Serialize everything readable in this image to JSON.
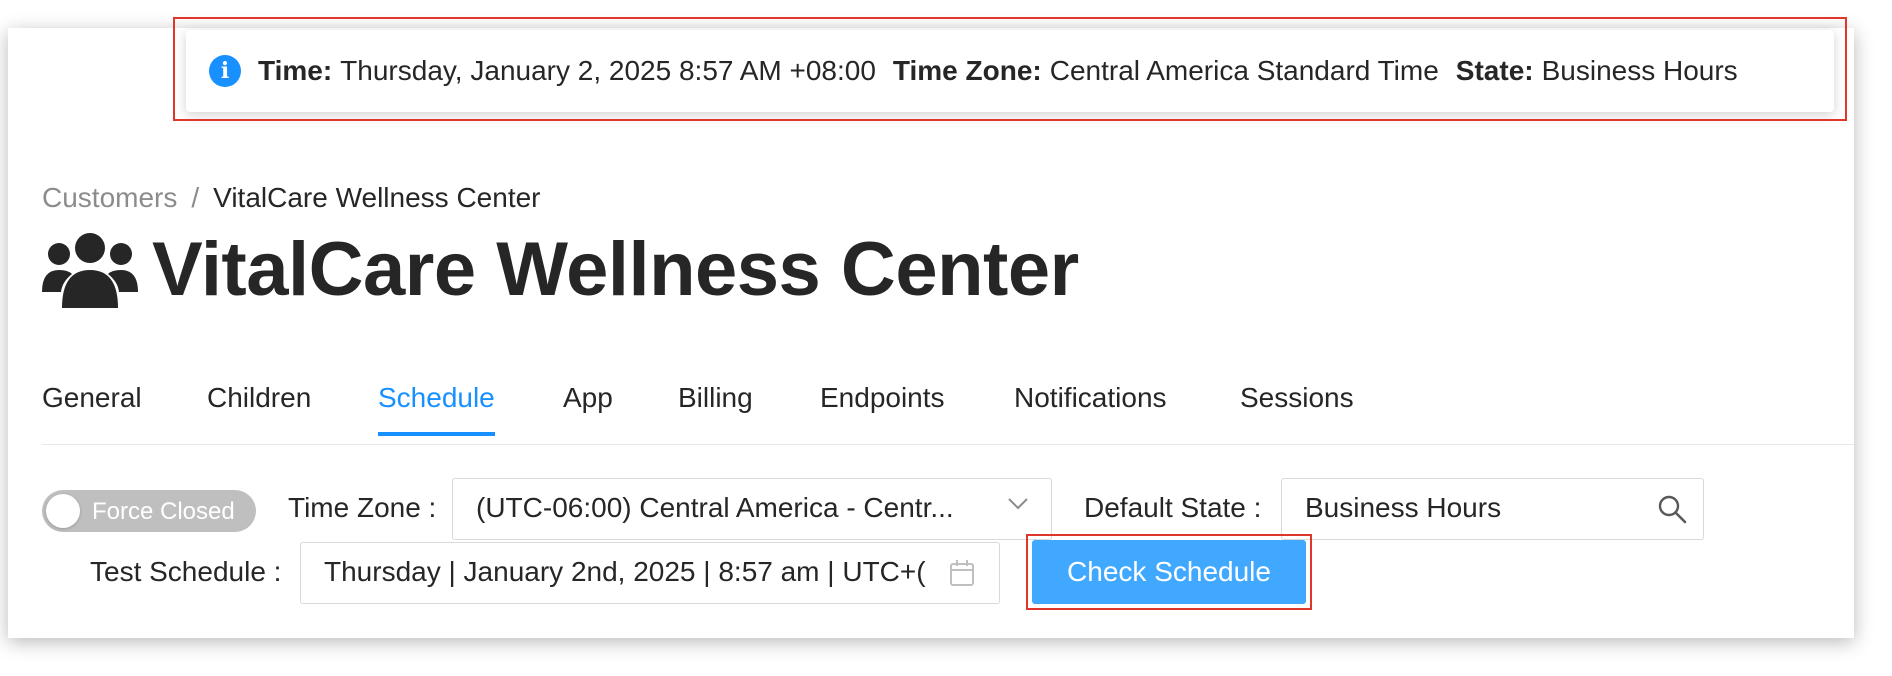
{
  "notification": {
    "time_label": "Time:",
    "time_value": "Thursday, January 2, 2025 8:57 AM +08:00",
    "timezone_label": "Time Zone:",
    "timezone_value": "Central America Standard Time",
    "state_label": "State:",
    "state_value": "Business Hours",
    "icon": "info-icon"
  },
  "breadcrumb": {
    "items": [
      "Customers",
      "VitalCare Wellness Center"
    ],
    "separator": "/"
  },
  "page": {
    "title": "VitalCare Wellness Center",
    "icon": "users-icon"
  },
  "tabs": [
    {
      "label": "General",
      "active": false
    },
    {
      "label": "Children",
      "active": false
    },
    {
      "label": "Schedule",
      "active": true
    },
    {
      "label": "App",
      "active": false
    },
    {
      "label": "Billing",
      "active": false
    },
    {
      "label": "Endpoints",
      "active": false
    },
    {
      "label": "Notifications",
      "active": false
    },
    {
      "label": "Sessions",
      "active": false
    }
  ],
  "schedule": {
    "force_closed_label": "Force Closed",
    "force_closed_on": false,
    "timezone_label": "Time Zone",
    "timezone_value": "(UTC-06:00) Central America - Centr...",
    "default_state_label": "Default State",
    "default_state_value": "Business Hours",
    "test_schedule_label": "Test Schedule",
    "test_schedule_value": "Thursday | January 2nd, 2025 | 8:57 am | UTC+(",
    "check_button_label": "Check Schedule"
  },
  "colors": {
    "accent": "#1890ff",
    "button": "#40a9ff",
    "highlight": "#e0362c",
    "toggle_off": "#bfbfbf"
  }
}
